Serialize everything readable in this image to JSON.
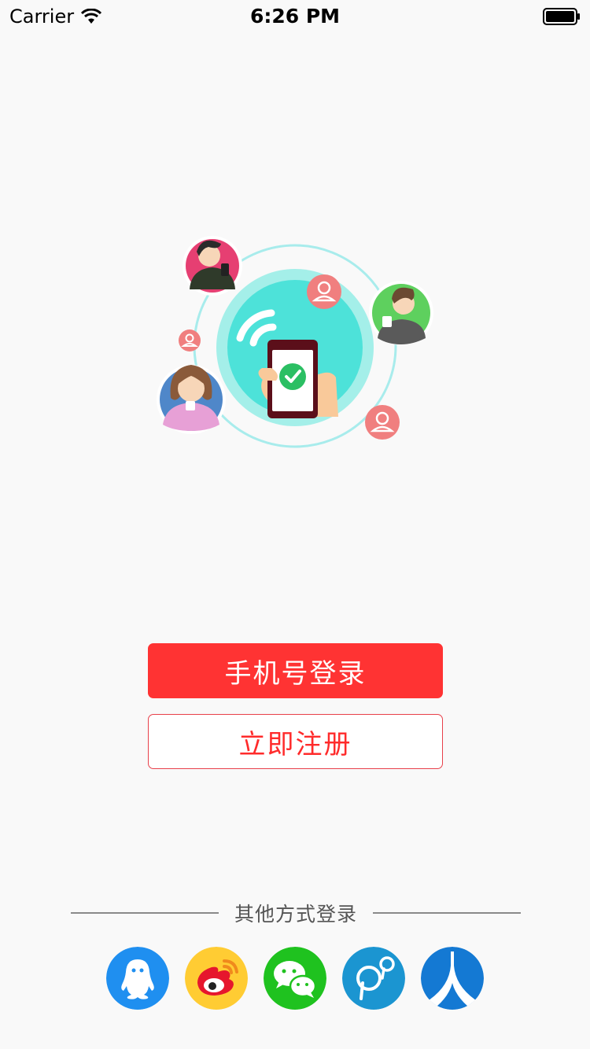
{
  "status_bar": {
    "carrier": "Carrier",
    "time": "6:26 PM"
  },
  "actions": {
    "login_label": "手机号登录",
    "register_label": "立即注册"
  },
  "other_login": {
    "label": "其他方式登录",
    "providers": [
      {
        "name": "qq",
        "icon": "qq-penguin-icon",
        "color": "#1f8ff0"
      },
      {
        "name": "weibo",
        "icon": "weibo-icon",
        "color": "#ffcc33"
      },
      {
        "name": "wechat",
        "icon": "wechat-icon",
        "color": "#1fc21f"
      },
      {
        "name": "pp",
        "icon": "pp-icon",
        "color": "#1b95d1"
      },
      {
        "name": "renren",
        "icon": "renren-icon",
        "color": "#1479d3"
      }
    ]
  },
  "colors": {
    "primary": "#ff3333",
    "background": "#f9f9f9"
  }
}
